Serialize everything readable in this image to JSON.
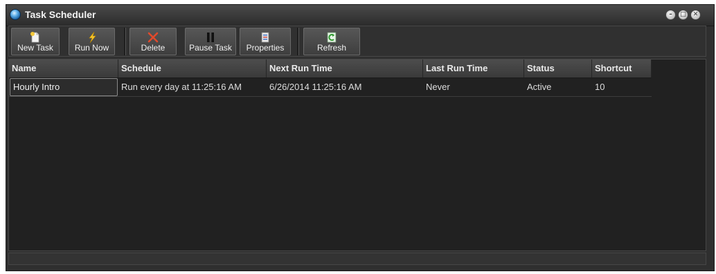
{
  "window": {
    "title": "Task Scheduler"
  },
  "titlebar": {
    "minimize_glyph": "–",
    "maximize_glyph": "□",
    "close_glyph": "✕"
  },
  "toolbar": {
    "buttons": [
      {
        "label": "New Task",
        "icon": "new-task-icon"
      },
      {
        "label": "Run Now",
        "icon": "lightning-icon"
      },
      {
        "label": "Delete",
        "icon": "delete-x-icon"
      },
      {
        "label": "Pause Task",
        "icon": "pause-icon"
      },
      {
        "label": "Properties",
        "icon": "properties-icon"
      },
      {
        "label": "Refresh",
        "icon": "refresh-icon"
      }
    ]
  },
  "table": {
    "columns": [
      "Name",
      "Schedule",
      "Next Run Time",
      "Last Run Time",
      "Status",
      "Shortcut"
    ],
    "rows": [
      [
        "Hourly Intro",
        "Run every day at 11:25:16 AM",
        "6/26/2014 11:25:16 AM",
        "Never",
        "Active",
        "10"
      ]
    ]
  }
}
